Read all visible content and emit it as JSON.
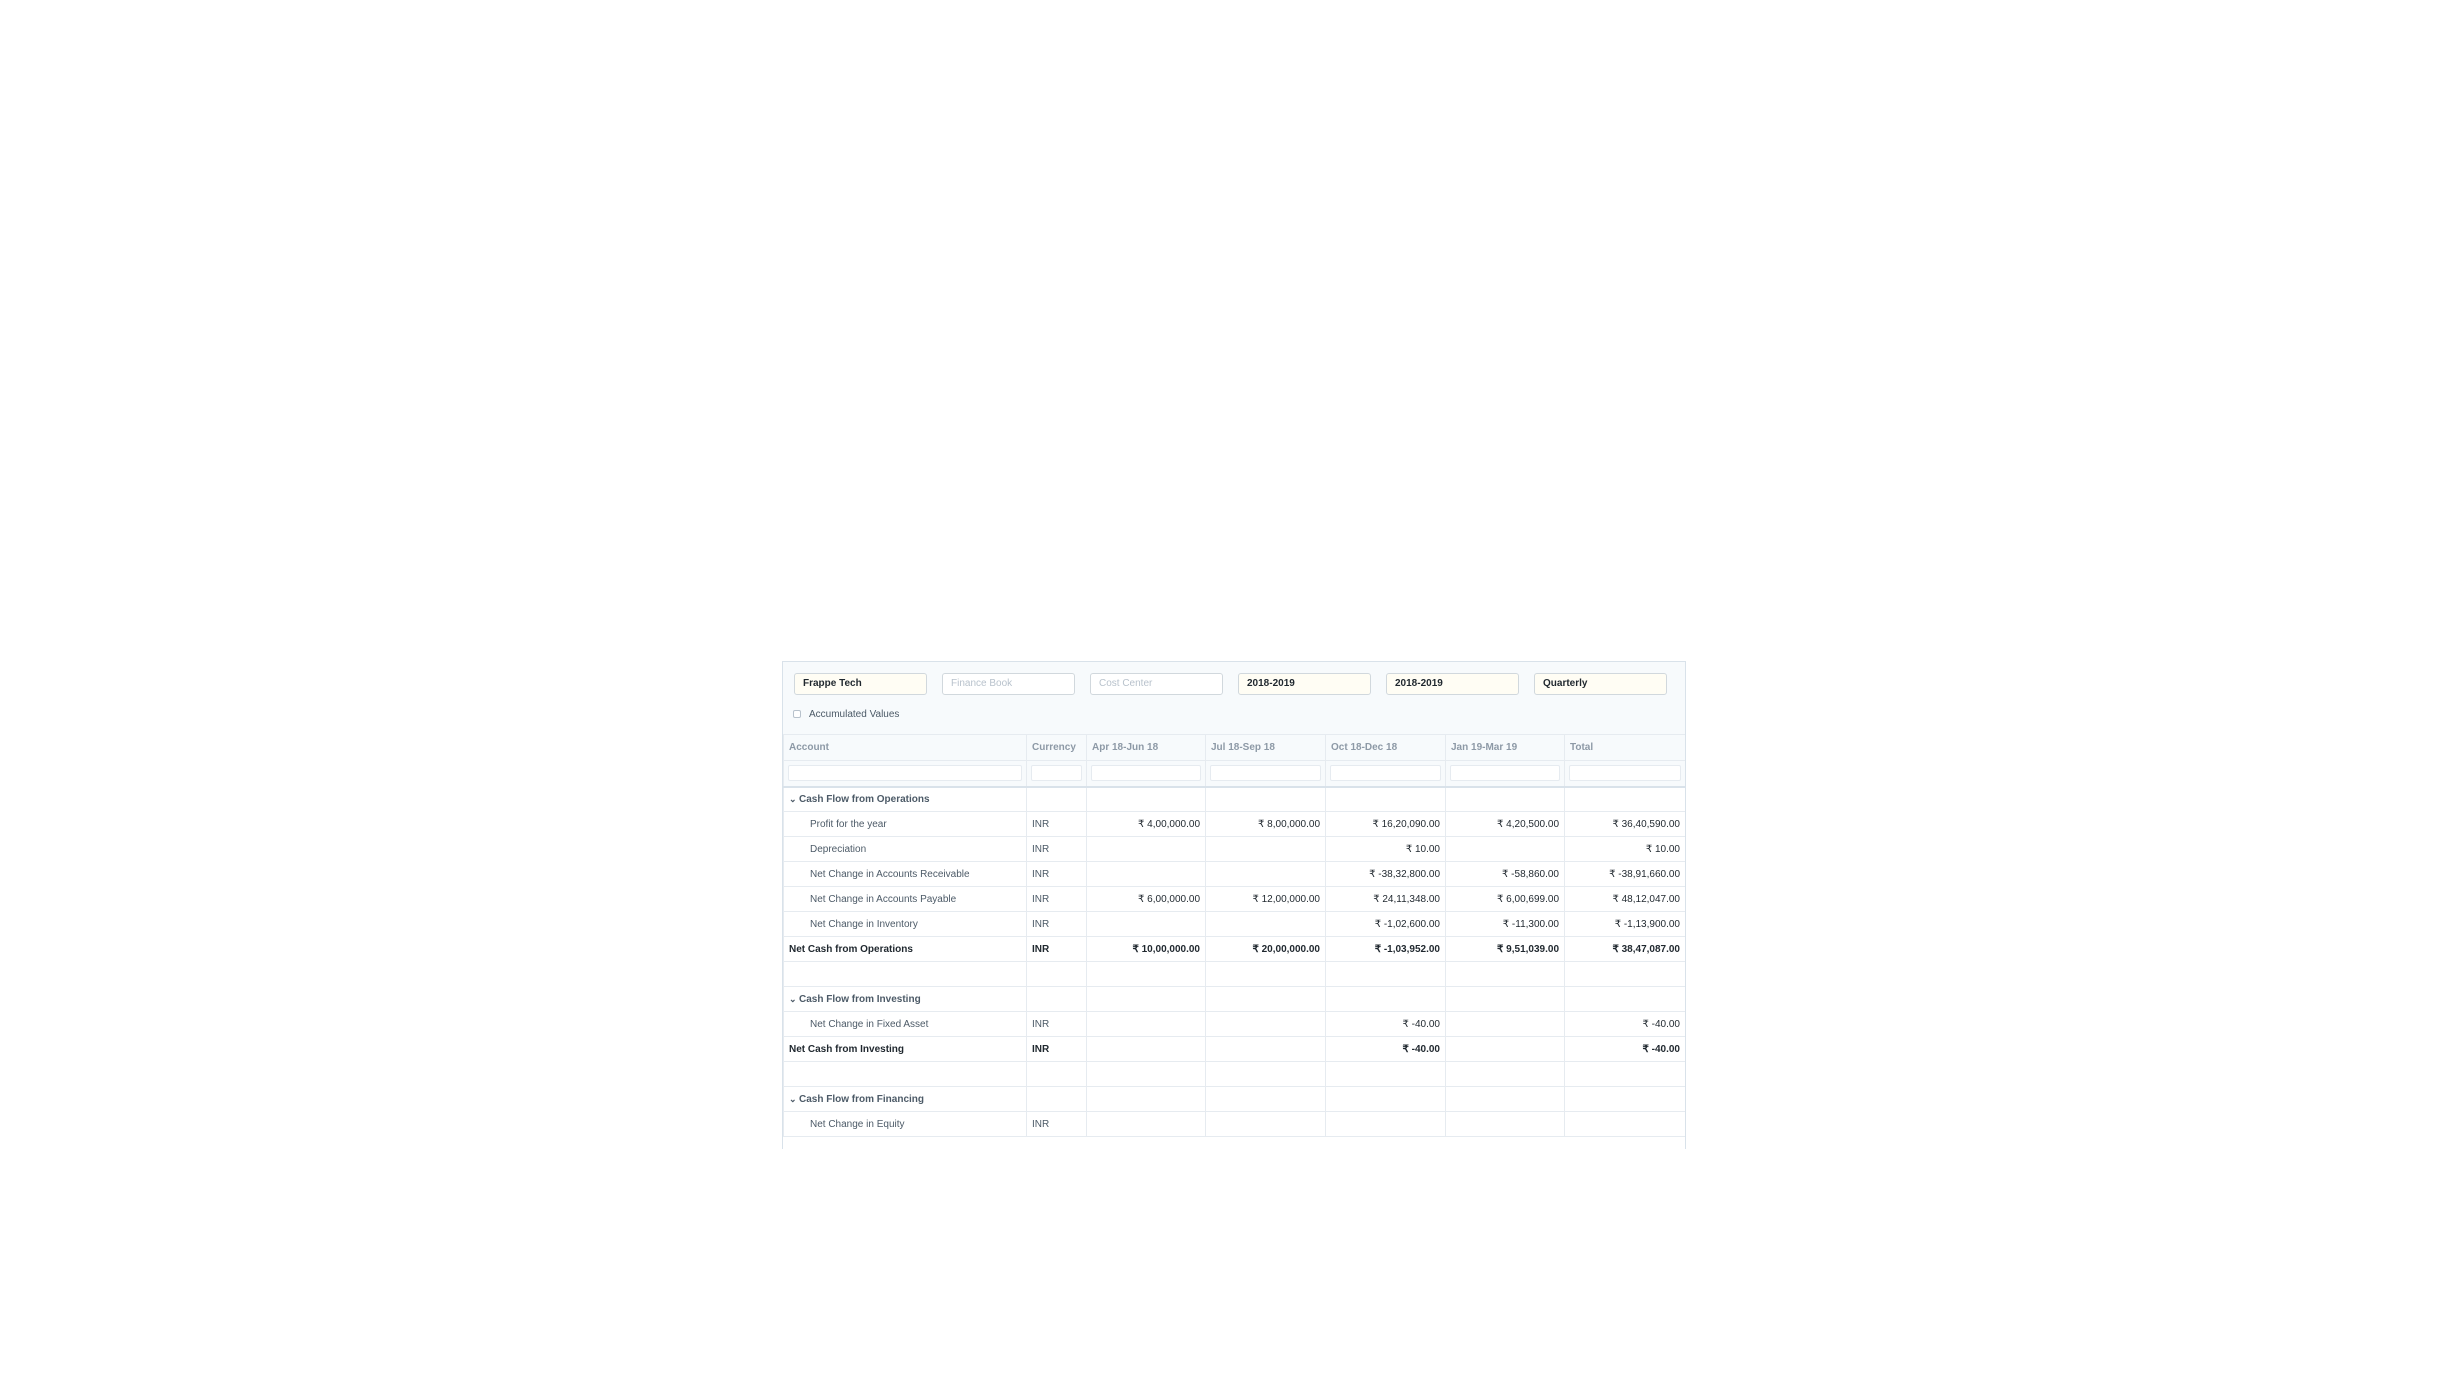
{
  "filters": {
    "company": "Frappe Tech",
    "finance_book_placeholder": "Finance Book",
    "cost_center_placeholder": "Cost Center",
    "from_fiscal_year": "2018-2019",
    "to_fiscal_year": "2018-2019",
    "periodicity": "Quarterly"
  },
  "accumulated_values_label": "Accumulated Values",
  "columns": [
    "Account",
    "Currency",
    "Apr 18-Jun 18",
    "Jul 18-Sep 18",
    "Oct 18-Dec 18",
    "Jan 19-Mar 19",
    "Total"
  ],
  "rows": [
    {
      "type": "group",
      "cells": [
        "Cash Flow from Operations",
        "",
        "",
        "",
        "",
        "",
        ""
      ]
    },
    {
      "type": "child",
      "cells": [
        "Profit for the year",
        "INR",
        "₹ 4,00,000.00",
        "₹ 8,00,000.00",
        "₹ 16,20,090.00",
        "₹ 4,20,500.00",
        "₹ 36,40,590.00"
      ]
    },
    {
      "type": "child",
      "cells": [
        "Depreciation",
        "INR",
        "",
        "",
        "₹ 10.00",
        "",
        "₹ 10.00"
      ]
    },
    {
      "type": "child",
      "cells": [
        "Net Change in Accounts Receivable",
        "INR",
        "",
        "",
        "₹ -38,32,800.00",
        "₹ -58,860.00",
        "₹ -38,91,660.00"
      ]
    },
    {
      "type": "child",
      "cells": [
        "Net Change in Accounts Payable",
        "INR",
        "₹ 6,00,000.00",
        "₹ 12,00,000.00",
        "₹ 24,11,348.00",
        "₹ 6,00,699.00",
        "₹ 48,12,047.00"
      ]
    },
    {
      "type": "child",
      "cells": [
        "Net Change in Inventory",
        "INR",
        "",
        "",
        "₹ -1,02,600.00",
        "₹ -11,300.00",
        "₹ -1,13,900.00"
      ]
    },
    {
      "type": "total",
      "cells": [
        "Net Cash from Operations",
        "INR",
        "₹ 10,00,000.00",
        "₹ 20,00,000.00",
        "₹ -1,03,952.00",
        "₹ 9,51,039.00",
        "₹ 38,47,087.00"
      ]
    },
    {
      "type": "blank",
      "cells": [
        "",
        "",
        "",
        "",
        "",
        "",
        ""
      ]
    },
    {
      "type": "group",
      "cells": [
        "Cash Flow from Investing",
        "",
        "",
        "",
        "",
        "",
        ""
      ]
    },
    {
      "type": "child",
      "cells": [
        "Net Change in Fixed Asset",
        "INR",
        "",
        "",
        "₹ -40.00",
        "",
        "₹ -40.00"
      ]
    },
    {
      "type": "total",
      "cells": [
        "Net Cash from Investing",
        "INR",
        "",
        "",
        "₹ -40.00",
        "",
        "₹ -40.00"
      ]
    },
    {
      "type": "blank",
      "cells": [
        "",
        "",
        "",
        "",
        "",
        "",
        ""
      ]
    },
    {
      "type": "group",
      "cells": [
        "Cash Flow from Financing",
        "",
        "",
        "",
        "",
        "",
        ""
      ]
    },
    {
      "type": "child",
      "cells": [
        "Net Change in Equity",
        "INR",
        "",
        "",
        "",
        "",
        ""
      ]
    }
  ]
}
